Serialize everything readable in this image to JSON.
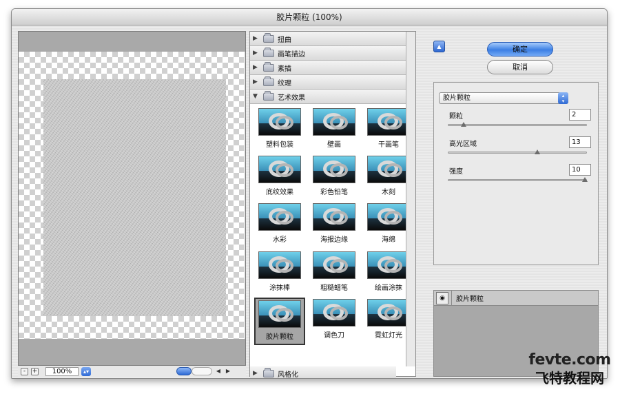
{
  "window": {
    "title": "胶片颗粒 (100%)"
  },
  "preview": {
    "zoom_value": "100%",
    "zoom_out_label": "-",
    "zoom_in_label": "+"
  },
  "gallery": {
    "folders_above": [
      {
        "label": "扭曲"
      },
      {
        "label": "画笔描边"
      },
      {
        "label": "素描"
      },
      {
        "label": "纹理"
      }
    ],
    "open_folder": {
      "label": "艺术效果"
    },
    "filters": [
      {
        "label": "塑料包装"
      },
      {
        "label": "壁画"
      },
      {
        "label": "干画笔"
      },
      {
        "label": "底纹效果"
      },
      {
        "label": "彩色铅笔"
      },
      {
        "label": "木刻"
      },
      {
        "label": "水彩"
      },
      {
        "label": "海报边缘"
      },
      {
        "label": "海绵"
      },
      {
        "label": "涂抹棒"
      },
      {
        "label": "粗糙蜡笔"
      },
      {
        "label": "绘画涂抹"
      },
      {
        "label": "胶片颗粒"
      },
      {
        "label": "调色刀"
      },
      {
        "label": "霓虹灯光"
      }
    ],
    "selected_filter": "胶片颗粒",
    "folders_below": [
      {
        "label": "风格化"
      }
    ]
  },
  "buttons": {
    "ok": "确定",
    "cancel": "取消"
  },
  "settings": {
    "filter_select": "胶片颗粒",
    "params": [
      {
        "label": "颗粒",
        "value": "2",
        "fraction": 0.1
      },
      {
        "label": "高光区域",
        "value": "13",
        "fraction": 0.65
      },
      {
        "label": "强度",
        "value": "10",
        "fraction": 1.0
      }
    ]
  },
  "layers": {
    "items": [
      {
        "label": "胶片颗粒"
      }
    ]
  },
  "watermark": {
    "line1": "fevte.com",
    "line2": "飞特教程网"
  }
}
